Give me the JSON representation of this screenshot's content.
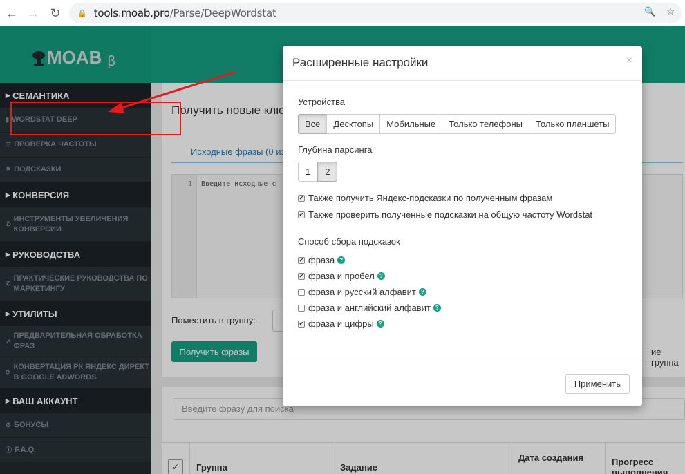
{
  "browser": {
    "url_host": "tools.moab.pro",
    "url_path": "/Parse/DeepWordstat"
  },
  "logo": {
    "text": "MOAB",
    "beta": "β"
  },
  "sidebar": {
    "sections": [
      {
        "title": "СЕМАНТИКА",
        "items": [
          {
            "label": "WORDSTAT DEEP",
            "icon": "bar-chart-icon"
          },
          {
            "label": "ПРОВЕРКА ЧАСТОТЫ",
            "icon": "list-icon"
          },
          {
            "label": "ПОДСКАЗКИ",
            "icon": "tag-icon"
          }
        ]
      },
      {
        "title": "КОНВЕРСИЯ",
        "items": [
          {
            "label": "ИНСТРУМЕНТЫ УВЕЛИЧЕНИЯ КОНВЕРСИИ",
            "icon": "phone-icon"
          }
        ]
      },
      {
        "title": "РУКОВОДСТВА",
        "items": [
          {
            "label": "ПРАКТИЧЕСКИЕ РУКОВОДСТВА ПО МАРКЕТИНГУ",
            "icon": "phone-icon"
          }
        ]
      },
      {
        "title": "УТИЛИТЫ",
        "items": [
          {
            "label": "ПРЕДВАРИТЕЛЬНАЯ ОБРАБОТКА ФРАЗ",
            "icon": "wand-icon"
          },
          {
            "label": "КОНВЕРТАЦИЯ РК ЯНДЕКС ДИРЕКТ В GOOGLE ADWORDS",
            "icon": "refresh-icon"
          }
        ]
      },
      {
        "title": "ВАШ АККАУНТ",
        "items": [
          {
            "label": "БОНУСЫ",
            "icon": "gear-icon"
          },
          {
            "label": "F.A.Q.",
            "icon": "question-icon"
          }
        ]
      }
    ]
  },
  "main": {
    "title": "Получить новые клю",
    "tab": "Исходные фразы (0 из 1",
    "editor_line": "1",
    "editor_placeholder": "Введите исходные с",
    "group_label": "Поместить в группу:",
    "get_button": "Получить фразы",
    "groups_text": "ие группа",
    "search_placeholder": "Введите фразу для поиска",
    "table_headers": [
      "Группа",
      "Задание",
      "Дата создания",
      "Прогресс выполнения"
    ]
  },
  "modal": {
    "title": "Расширенные настройки",
    "close": "×",
    "devices_label": "Устройства",
    "devices": [
      "Все",
      "Десктопы",
      "Мобильные",
      "Только телефоны",
      "Только планшеты"
    ],
    "devices_active": "Все",
    "depth_label": "Глубина парсинга",
    "depth": [
      "1",
      "2"
    ],
    "depth_active": "2",
    "options": [
      {
        "label": "Также получить Яндекс-подсказки по полученным фразам",
        "checked": true
      },
      {
        "label": "Также проверить полученные подсказки на общую частоту Wordstat",
        "checked": true
      }
    ],
    "method_label": "Способ сбора подсказок",
    "methods": [
      {
        "label": "фраза",
        "checked": true
      },
      {
        "label": "фраза и пробел",
        "checked": true
      },
      {
        "label": "фраза и русский алфавит",
        "checked": false
      },
      {
        "label": "фраза и английский алфавит",
        "checked": false
      },
      {
        "label": "фраза и цифры",
        "checked": true
      }
    ],
    "apply_button": "Применить"
  },
  "colors": {
    "accent": "#16a085",
    "sidebar": "#222a2f",
    "annotation": "#e31b1b"
  }
}
